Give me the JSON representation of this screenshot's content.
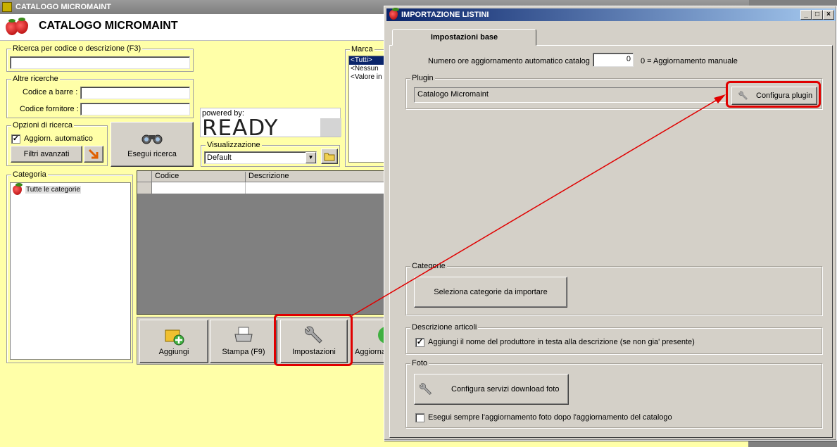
{
  "main": {
    "window_title": "CATALOGO MICROMAINT",
    "app_title": "CATALOGO MICROMAINT",
    "search_group": {
      "label": "Ricerca per codice o descrizione (F3)",
      "value": ""
    },
    "other_search": {
      "label": "Altre ricerche",
      "barcode_label": "Codice a barre :",
      "barcode_value": "",
      "supplier_label": "Codice fornitore :",
      "supplier_value": ""
    },
    "search_options": {
      "label": "Opzioni di ricerca",
      "auto_update_label": "Aggiorn. automatico",
      "auto_update_checked": true,
      "advanced_filters_label": "Filtri avanzati"
    },
    "search_button": "Esegui ricerca",
    "powered_by": "powered by:",
    "ready_logo": "READY",
    "view_group": {
      "label": "Visualizzazione",
      "selected": "Default"
    },
    "brand_group": {
      "label": "Marca",
      "items": [
        "<Tutti>",
        "<Nessun",
        "<Valore in"
      ]
    },
    "category_group": {
      "label": "Categoria",
      "items": [
        "Tutte le categorie"
      ]
    },
    "grid": {
      "columns": [
        "Codice",
        "Descrizione"
      ]
    },
    "toolbar": {
      "add": "Aggiungi",
      "print": "Stampa (F9)",
      "settings": "Impostazioni",
      "update": "Aggiorna"
    }
  },
  "dialog": {
    "title": "IMPORTAZIONE LISTINI",
    "tab": "Impostazioni base",
    "hours_label": "Numero ore aggiornamento automatico catalog :",
    "hours_value": "0",
    "hours_hint": "0 = Aggiornamento manuale",
    "plugin_group": {
      "label": "Plugin",
      "value": "Catalogo Micromaint",
      "button": "Configura plugin"
    },
    "categories_group": {
      "label": "Categorie",
      "button": "Seleziona categorie da importare"
    },
    "description_group": {
      "label": "Descrizione articoli",
      "checkbox_label": "Aggiungi il nome del produttore in testa alla descrizione (se non gia' presente)",
      "checked": true
    },
    "photo_group": {
      "label": "Foto",
      "button": "Configura servizi download foto",
      "checkbox_label": "Esegui sempre l'aggiornamento foto dopo l'aggiornamento del catalogo",
      "checked": false
    }
  },
  "colors": {
    "highlight": "#e00000",
    "main_bg": "#ffffa8",
    "dialog_bg": "#d4d0c8",
    "title_active": "#0a246a"
  }
}
